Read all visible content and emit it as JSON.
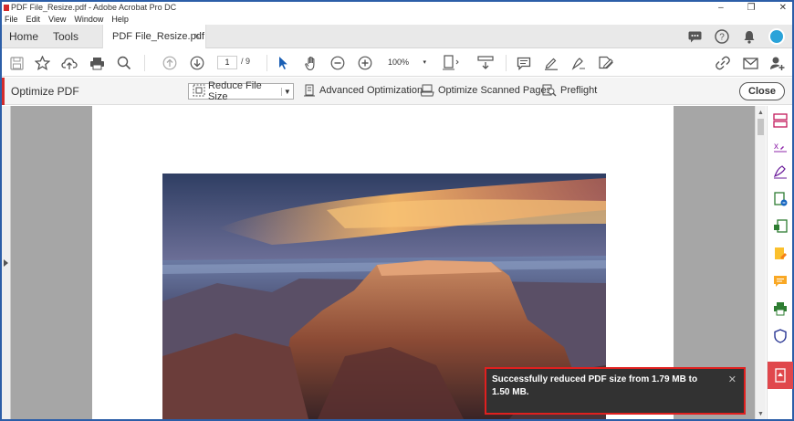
{
  "window": {
    "title": "PDF File_Resize.pdf - Adobe Acrobat Pro DC",
    "controls": [
      "–",
      "❐",
      "✕"
    ]
  },
  "menu": [
    "File",
    "Edit",
    "View",
    "Window",
    "Help"
  ],
  "tabs": {
    "home": "Home",
    "tools": "Tools",
    "document": "PDF File_Resize.pdf",
    "close": "×"
  },
  "tab_icons": [
    "chat-icon",
    "help-icon",
    "bell-icon",
    "avatar"
  ],
  "toolbar": {
    "current_page": "1",
    "total_pages": "/ 9",
    "zoom": "100%",
    "icons": [
      "save-icon",
      "star-icon",
      "cloud-upload-icon",
      "print-icon",
      "search-icon",
      "page-up-icon",
      "page-down-icon",
      "select-cursor-icon",
      "hand-icon",
      "zoom-out-icon",
      "zoom-in-icon",
      "fit-page-icon",
      "scroll-mode-icon",
      "comment-icon",
      "highlight-icon",
      "sign-icon",
      "edit-icon",
      "link-icon",
      "mail-icon",
      "add-user-icon"
    ]
  },
  "optimize": {
    "label": "Optimize PDF",
    "reduce": "Reduce File Size",
    "advanced": "Advanced Optimization",
    "scanned": "Optimize Scanned Pages",
    "preflight": "Preflight",
    "close": "Close"
  },
  "right_panel": [
    "organize-pages-icon",
    "fill-sign-icon",
    "sign-icon",
    "export-pdf-icon",
    "create-pdf-icon",
    "edit-pdf-icon",
    "comment-icon",
    "print-production-icon",
    "protect-icon",
    "optimize-pdf-icon"
  ],
  "toast": {
    "message": "Successfully reduced PDF size from 1.79 MB to 1.50 MB.",
    "close": "✕"
  }
}
